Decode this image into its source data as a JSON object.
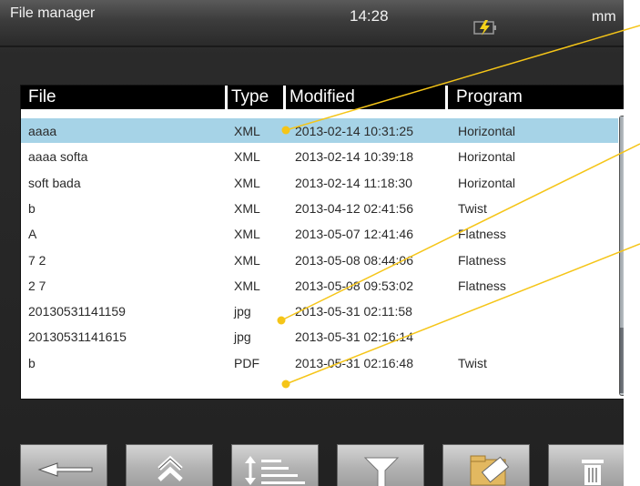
{
  "statusbar": {
    "title": "File manager",
    "time": "14:28",
    "units": "mm",
    "battery_icon": "battery-charging-icon"
  },
  "table": {
    "columns": [
      "File",
      "Type",
      "Modified",
      "Program"
    ],
    "rows": [
      {
        "file": "aaaa",
        "type": "XML",
        "modified": "2013-02-14 10:31:25",
        "program": "Horizontal",
        "selected": true
      },
      {
        "file": "aaaa softa",
        "type": "XML",
        "modified": "2013-02-14 10:39:18",
        "program": "Horizontal"
      },
      {
        "file": "soft bada",
        "type": "XML",
        "modified": "2013-02-14 11:18:30",
        "program": "Horizontal"
      },
      {
        "file": "b",
        "type": "XML",
        "modified": "2013-04-12 02:41:56",
        "program": "Twist"
      },
      {
        "file": "A",
        "type": "XML",
        "modified": "2013-05-07 12:41:46",
        "program": "Flatness"
      },
      {
        "file": "7 2",
        "type": "XML",
        "modified": "2013-05-08 08:44:06",
        "program": "Flatness"
      },
      {
        "file": "2 7",
        "type": "XML",
        "modified": "2013-05-08 09:53:02",
        "program": "Flatness"
      },
      {
        "file": "20130531141159",
        "type": "jpg",
        "modified": "2013-05-31 02:11:58",
        "program": ""
      },
      {
        "file": "20130531141615",
        "type": "jpg",
        "modified": "2013-05-31 02:16:14",
        "program": ""
      },
      {
        "file": "b",
        "type": "PDF",
        "modified": "2013-05-31 02:16:48",
        "program": "Twist"
      }
    ]
  },
  "toolbar": {
    "buttons": [
      "back-arrow-icon",
      "scroll-top-icon",
      "sort-icon",
      "filter-icon",
      "usb-folder-icon",
      "trash-icon"
    ]
  },
  "colors": {
    "selection": "#a6d3e7",
    "callout": "#f5c518",
    "header_bg": "#000000"
  }
}
